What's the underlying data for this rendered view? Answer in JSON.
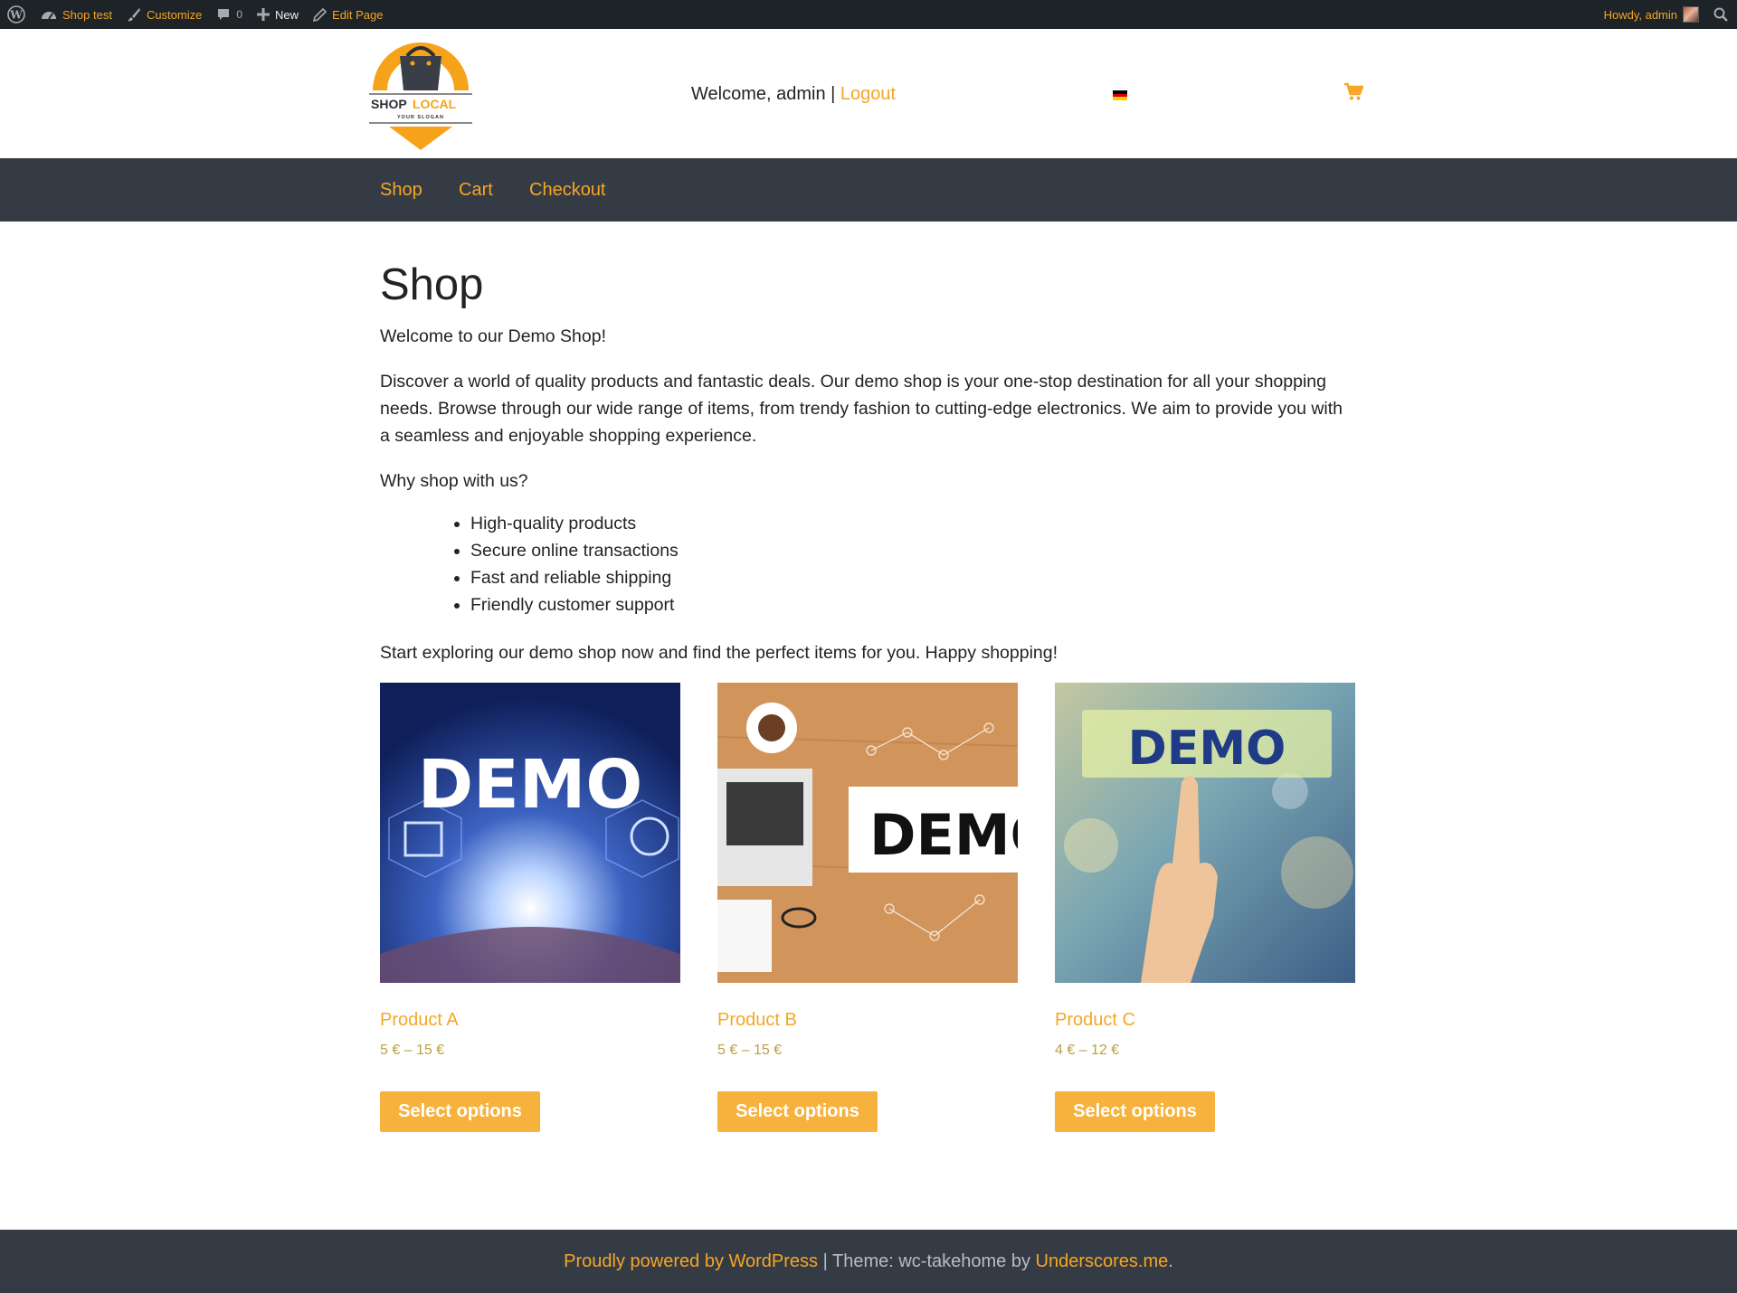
{
  "admin_bar": {
    "site_name": "Shop test",
    "customize": "Customize",
    "comments_count": "0",
    "new": "New",
    "edit_page": "Edit Page",
    "greeting": "Howdy, admin"
  },
  "header": {
    "logo_brand_1": "SHOP",
    "logo_brand_2": "LOCAL",
    "logo_slogan": "YOUR SLOGAN",
    "welcome_text": "Welcome, admin | ",
    "logout_label": "Logout",
    "language_flag": "de-flag-icon",
    "cart_icon": "shopping-cart-icon"
  },
  "nav": {
    "items": [
      {
        "label": "Shop"
      },
      {
        "label": "Cart"
      },
      {
        "label": "Checkout"
      }
    ]
  },
  "page": {
    "title": "Shop",
    "intro": "Welcome to our Demo Shop!",
    "description": "Discover a world of quality products and fantastic deals. Our demo shop is your one-stop destination for all your shopping needs. Browse through our wide range of items, from trendy fashion to cutting-edge electronics. We aim to provide you with a seamless and enjoyable shopping experience.",
    "why_heading": "Why shop with us?",
    "benefits": [
      "High-quality products",
      "Secure online transactions",
      "Fast and reliable shipping",
      "Friendly customer support"
    ],
    "closing": "Start exploring our demo shop now and find the perfect items for you. Happy shopping!"
  },
  "products": [
    {
      "name": "Product A",
      "price": "5 € – 15 €",
      "button": "Select options",
      "image_text": "DEMO"
    },
    {
      "name": "Product B",
      "price": "5 € – 15 €",
      "button": "Select options",
      "image_text": "DEMO"
    },
    {
      "name": "Product C",
      "price": "4 € – 12 €",
      "button": "Select options",
      "image_text": "DEMO"
    }
  ],
  "footer": {
    "powered_by": "Proudly powered by WordPress",
    "separator": " | Theme: wc-takehome by ",
    "theme_author": "Underscores.me",
    "end": "."
  },
  "colors": {
    "accent": "#f5a623",
    "nav_bg": "#353b45",
    "admin_bar_bg": "#1d2327",
    "button_bg": "#f6b23d",
    "price": "#b8a244"
  }
}
